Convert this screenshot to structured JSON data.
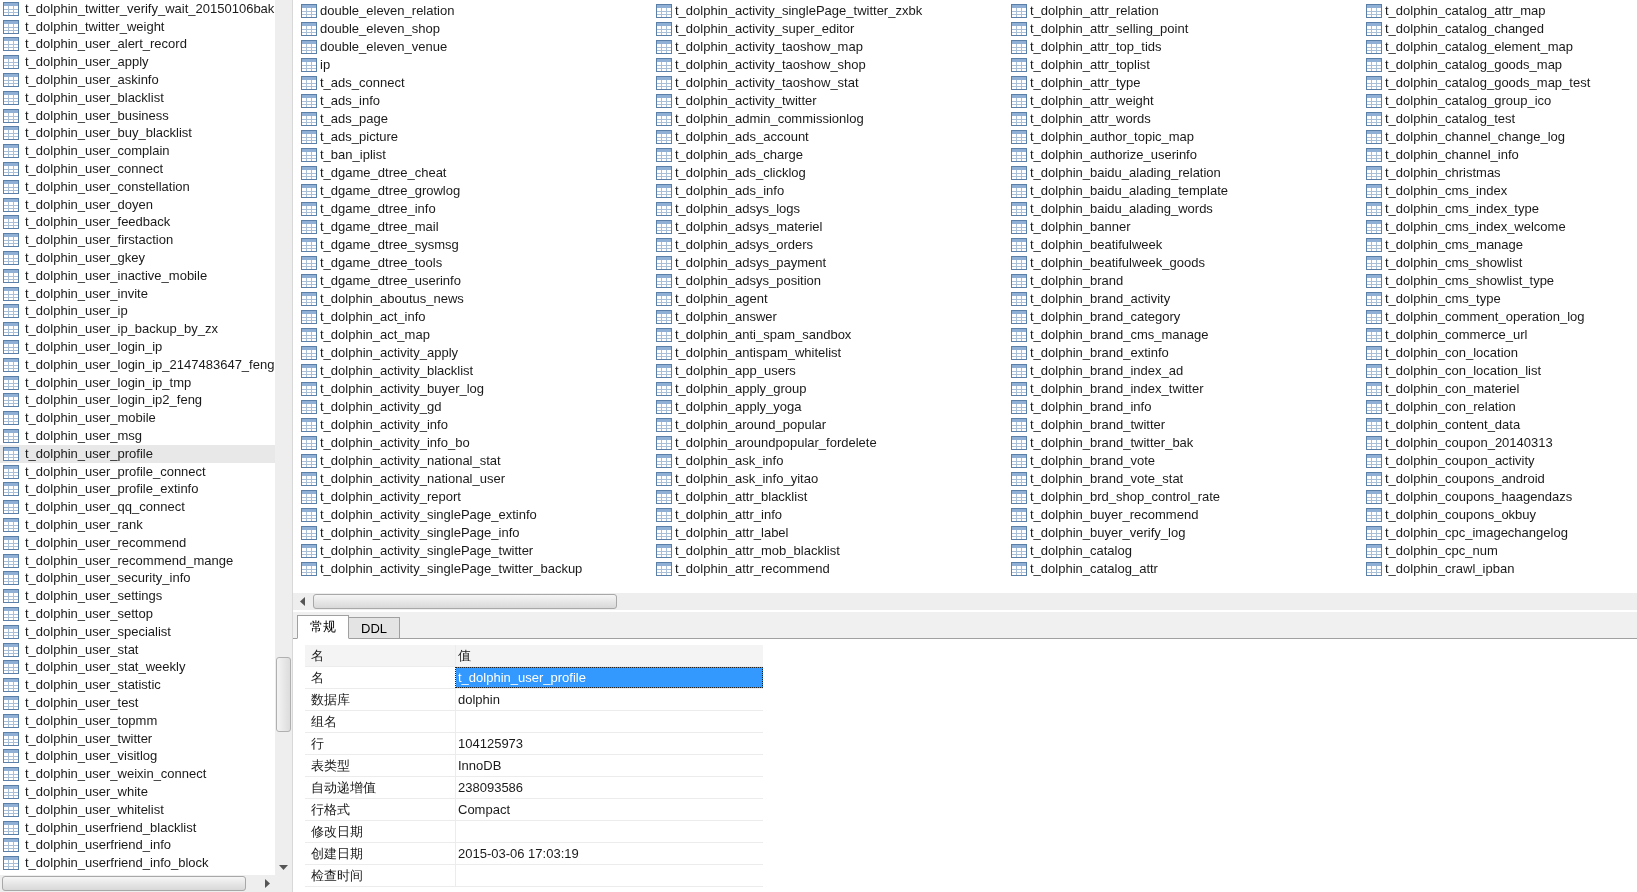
{
  "sidebar": {
    "items": [
      {
        "label": "t_dolphin_twitter_verify_wait_20150106bak",
        "selected": false
      },
      {
        "label": "t_dolphin_twitter_weight",
        "selected": false
      },
      {
        "label": "t_dolphin_user_alert_record",
        "selected": false
      },
      {
        "label": "t_dolphin_user_apply",
        "selected": false
      },
      {
        "label": "t_dolphin_user_askinfo",
        "selected": false
      },
      {
        "label": "t_dolphin_user_blacklist",
        "selected": false
      },
      {
        "label": "t_dolphin_user_business",
        "selected": false
      },
      {
        "label": "t_dolphin_user_buy_blacklist",
        "selected": false
      },
      {
        "label": "t_dolphin_user_complain",
        "selected": false
      },
      {
        "label": "t_dolphin_user_connect",
        "selected": false
      },
      {
        "label": "t_dolphin_user_constellation",
        "selected": false
      },
      {
        "label": "t_dolphin_user_doyen",
        "selected": false
      },
      {
        "label": "t_dolphin_user_feedback",
        "selected": false
      },
      {
        "label": "t_dolphin_user_firstaction",
        "selected": false
      },
      {
        "label": "t_dolphin_user_gkey",
        "selected": false
      },
      {
        "label": "t_dolphin_user_inactive_mobile",
        "selected": false
      },
      {
        "label": "t_dolphin_user_invite",
        "selected": false
      },
      {
        "label": "t_dolphin_user_ip",
        "selected": false
      },
      {
        "label": "t_dolphin_user_ip_backup_by_zx",
        "selected": false
      },
      {
        "label": "t_dolphin_user_login_ip",
        "selected": false
      },
      {
        "label": "t_dolphin_user_login_ip_2147483647_feng",
        "selected": false
      },
      {
        "label": "t_dolphin_user_login_ip_tmp",
        "selected": false
      },
      {
        "label": "t_dolphin_user_login_ip2_feng",
        "selected": false
      },
      {
        "label": "t_dolphin_user_mobile",
        "selected": false
      },
      {
        "label": "t_dolphin_user_msg",
        "selected": false
      },
      {
        "label": "t_dolphin_user_profile",
        "selected": true
      },
      {
        "label": "t_dolphin_user_profile_connect",
        "selected": false
      },
      {
        "label": "t_dolphin_user_profile_extinfo",
        "selected": false
      },
      {
        "label": "t_dolphin_user_qq_connect",
        "selected": false
      },
      {
        "label": "t_dolphin_user_rank",
        "selected": false
      },
      {
        "label": "t_dolphin_user_recommend",
        "selected": false
      },
      {
        "label": "t_dolphin_user_recommend_mange",
        "selected": false
      },
      {
        "label": "t_dolphin_user_security_info",
        "selected": false
      },
      {
        "label": "t_dolphin_user_settings",
        "selected": false
      },
      {
        "label": "t_dolphin_user_settop",
        "selected": false
      },
      {
        "label": "t_dolphin_user_specialist",
        "selected": false
      },
      {
        "label": "t_dolphin_user_stat",
        "selected": false
      },
      {
        "label": "t_dolphin_user_stat_weekly",
        "selected": false
      },
      {
        "label": "t_dolphin_user_statistic",
        "selected": false
      },
      {
        "label": "t_dolphin_user_test",
        "selected": false
      },
      {
        "label": "t_dolphin_user_topmm",
        "selected": false
      },
      {
        "label": "t_dolphin_user_twitter",
        "selected": false
      },
      {
        "label": "t_dolphin_user_visitlog",
        "selected": false
      },
      {
        "label": "t_dolphin_user_weixin_connect",
        "selected": false
      },
      {
        "label": "t_dolphin_user_white",
        "selected": false
      },
      {
        "label": "t_dolphin_user_whitelist",
        "selected": false
      },
      {
        "label": "t_dolphin_userfriend_blacklist",
        "selected": false
      },
      {
        "label": "t_dolphin_userfriend_info",
        "selected": false
      },
      {
        "label": "t_dolphin_userfriend_info_block",
        "selected": false
      }
    ]
  },
  "tables": {
    "columns": [
      [
        "double_eleven_relation",
        "double_eleven_shop",
        "double_eleven_venue",
        "ip",
        "t_ads_connect",
        "t_ads_info",
        "t_ads_page",
        "t_ads_picture",
        "t_ban_iplist",
        "t_dgame_dtree_cheat",
        "t_dgame_dtree_growlog",
        "t_dgame_dtree_info",
        "t_dgame_dtree_mail",
        "t_dgame_dtree_sysmsg",
        "t_dgame_dtree_tools",
        "t_dgame_dtree_userinfo",
        "t_dolphin_aboutus_news",
        "t_dolphin_act_info",
        "t_dolphin_act_map",
        "t_dolphin_activity_apply",
        "t_dolphin_activity_blacklist",
        "t_dolphin_activity_buyer_log",
        "t_dolphin_activity_gd",
        "t_dolphin_activity_info",
        "t_dolphin_activity_info_bo",
        "t_dolphin_activity_national_stat",
        "t_dolphin_activity_national_user",
        "t_dolphin_activity_report",
        "t_dolphin_activity_singlePage_extinfo",
        "t_dolphin_activity_singlePage_info",
        "t_dolphin_activity_singlePage_twitter",
        "t_dolphin_activity_singlePage_twitter_backup"
      ],
      [
        "t_dolphin_activity_singlePage_twitter_zxbk",
        "t_dolphin_activity_super_editor",
        "t_dolphin_activity_taoshow_map",
        "t_dolphin_activity_taoshow_shop",
        "t_dolphin_activity_taoshow_stat",
        "t_dolphin_activity_twitter",
        "t_dolphin_admin_commissionlog",
        "t_dolphin_ads_account",
        "t_dolphin_ads_charge",
        "t_dolphin_ads_clicklog",
        "t_dolphin_ads_info",
        "t_dolphin_adsys_logs",
        "t_dolphin_adsys_materiel",
        "t_dolphin_adsys_orders",
        "t_dolphin_adsys_payment",
        "t_dolphin_adsys_position",
        "t_dolphin_agent",
        "t_dolphin_answer",
        "t_dolphin_anti_spam_sandbox",
        "t_dolphin_antispam_whitelist",
        "t_dolphin_app_users",
        "t_dolphin_apply_group",
        "t_dolphin_apply_yoga",
        "t_dolphin_around_popular",
        "t_dolphin_aroundpopular_fordelete",
        "t_dolphin_ask_info",
        "t_dolphin_ask_info_yitao",
        "t_dolphin_attr_blacklist",
        "t_dolphin_attr_info",
        "t_dolphin_attr_label",
        "t_dolphin_attr_mob_blacklist",
        "t_dolphin_attr_recommend"
      ],
      [
        "t_dolphin_attr_relation",
        "t_dolphin_attr_selling_point",
        "t_dolphin_attr_top_tids",
        "t_dolphin_attr_toplist",
        "t_dolphin_attr_type",
        "t_dolphin_attr_weight",
        "t_dolphin_attr_words",
        "t_dolphin_author_topic_map",
        "t_dolphin_authorize_userinfo",
        "t_dolphin_baidu_alading_relation",
        "t_dolphin_baidu_alading_template",
        "t_dolphin_baidu_alading_words",
        "t_dolphin_banner",
        "t_dolphin_beatifulweek",
        "t_dolphin_beatifulweek_goods",
        "t_dolphin_brand",
        "t_dolphin_brand_activity",
        "t_dolphin_brand_category",
        "t_dolphin_brand_cms_manage",
        "t_dolphin_brand_extinfo",
        "t_dolphin_brand_index_ad",
        "t_dolphin_brand_index_twitter",
        "t_dolphin_brand_info",
        "t_dolphin_brand_twitter",
        "t_dolphin_brand_twitter_bak",
        "t_dolphin_brand_vote",
        "t_dolphin_brand_vote_stat",
        "t_dolphin_brd_shop_control_rate",
        "t_dolphin_buyer_recommend",
        "t_dolphin_buyer_verify_log",
        "t_dolphin_catalog",
        "t_dolphin_catalog_attr"
      ],
      [
        "t_dolphin_catalog_attr_map",
        "t_dolphin_catalog_changed",
        "t_dolphin_catalog_element_map",
        "t_dolphin_catalog_goods_map",
        "t_dolphin_catalog_goods_map_test",
        "t_dolphin_catalog_group_ico",
        "t_dolphin_catalog_test",
        "t_dolphin_channel_change_log",
        "t_dolphin_channel_info",
        "t_dolphin_christmas",
        "t_dolphin_cms_index",
        "t_dolphin_cms_index_type",
        "t_dolphin_cms_index_welcome",
        "t_dolphin_cms_manage",
        "t_dolphin_cms_showlist",
        "t_dolphin_cms_showlist_type",
        "t_dolphin_cms_type",
        "t_dolphin_comment_operation_log",
        "t_dolphin_commerce_url",
        "t_dolphin_con_location",
        "t_dolphin_con_location_list",
        "t_dolphin_con_materiel",
        "t_dolphin_con_relation",
        "t_dolphin_content_data",
        "t_dolphin_coupon_20140313",
        "t_dolphin_coupon_activity",
        "t_dolphin_coupons_android",
        "t_dolphin_coupons_haagendazs",
        "t_dolphin_coupons_okbuy",
        "t_dolphin_cpc_imagechangelog",
        "t_dolphin_cpc_num",
        "t_dolphin_crawl_ipban"
      ]
    ]
  },
  "tabs": [
    {
      "label": "常规",
      "selected": true
    },
    {
      "label": "DDL",
      "selected": false
    }
  ],
  "properties": {
    "columns": [
      "名",
      "值"
    ],
    "rows": [
      {
        "name": "名",
        "value": "t_dolphin_user_profile",
        "selected": true
      },
      {
        "name": "数据库",
        "value": "dolphin",
        "selected": false
      },
      {
        "name": "组名",
        "selected": false
      },
      {
        "name": "行",
        "value": "104125973",
        "selected": false
      },
      {
        "name": "表类型",
        "value": "InnoDB",
        "selected": false
      },
      {
        "name": "自动递增值",
        "value": "238093586",
        "selected": false
      },
      {
        "name": "行格式",
        "value": "Compact",
        "selected": false
      },
      {
        "name": "修改日期",
        "selected": false
      },
      {
        "name": "创建日期",
        "value": "2015-03-06 17:03:19",
        "selected": false
      },
      {
        "name": "检查时间",
        "selected": false
      }
    ]
  }
}
